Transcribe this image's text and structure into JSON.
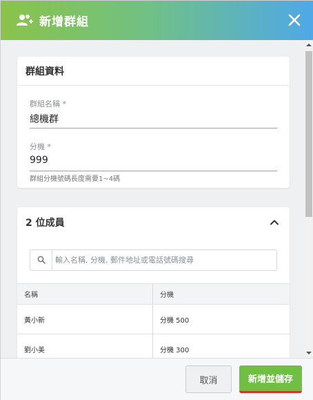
{
  "dialog": {
    "title": "新增群組",
    "header_icon": "add-user-icon",
    "close_icon": "close-icon"
  },
  "group_info": {
    "section_title": "群組資料",
    "name_label": "群組名稱 *",
    "name_value": "總機群",
    "ext_label": "分機 *",
    "ext_value": "999",
    "ext_hint": "群組分機號碼長度需要1~4碼"
  },
  "members": {
    "section_title": "2 位成員",
    "collapse_icon": "chevron-up-icon",
    "search_placeholder": "輸入名稱, 分機, 郵件地址或電話號碼搜尋",
    "columns": [
      "名稱",
      "分機"
    ],
    "rows": [
      {
        "name": "黃小新",
        "ext": "分機 500"
      },
      {
        "name": "劉小美",
        "ext": "分機 300"
      }
    ]
  },
  "footer": {
    "cancel_label": "取消",
    "save_label": "新增並儲存"
  },
  "colors": {
    "header_gradient_start": "#8bc34a",
    "header_gradient_end": "#4fa8e8",
    "save_button": "#6fbf43",
    "save_underline": "#d3362b"
  }
}
